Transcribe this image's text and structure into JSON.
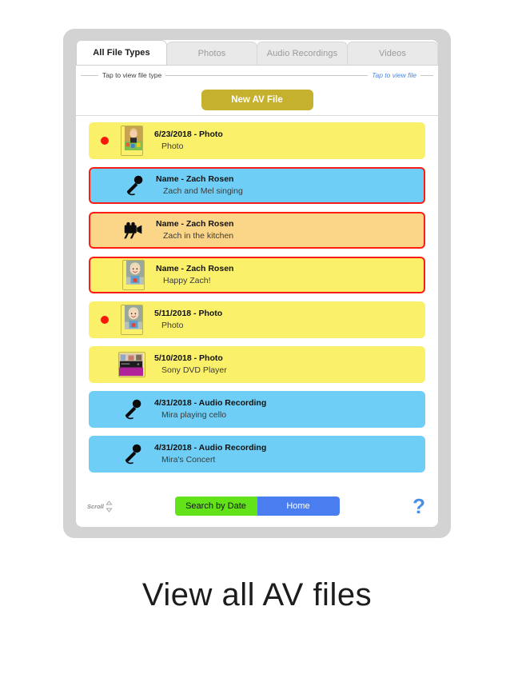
{
  "app": {
    "caption": "View all AV files"
  },
  "tabs": [
    {
      "label": "All File Types",
      "active": true
    },
    {
      "label": "Photos",
      "active": false
    },
    {
      "label": "Audio Recordings",
      "active": false
    },
    {
      "label": "Videos",
      "active": false
    }
  ],
  "annotations": {
    "left": "Tap to view file type",
    "right": "Tap to view file"
  },
  "toolbar": {
    "new_file_label": "New AV File"
  },
  "files": [
    {
      "title": "6/23/2018 - Photo",
      "subtitle": "Photo",
      "kind": "photo",
      "bg": "#FBF069",
      "selected": false,
      "dot": true,
      "thumb": "child-blocks"
    },
    {
      "title": "Name - Zach Rosen",
      "subtitle": "Zach and Mel singing",
      "kind": "audio",
      "bg": "#6FCEF5",
      "selected": true,
      "dot": false,
      "thumb": "microphone-icon"
    },
    {
      "title": "Name - Zach Rosen",
      "subtitle": "Zach in the kitchen",
      "kind": "video",
      "bg": "#FBD588",
      "selected": true,
      "dot": false,
      "thumb": "video-camera-icon"
    },
    {
      "title": "Name - Zach Rosen",
      "subtitle": "Happy Zach!",
      "kind": "photo",
      "bg": "#FBF069",
      "selected": true,
      "dot": false,
      "thumb": "child-smiling"
    },
    {
      "title": "5/11/2018 - Photo",
      "subtitle": "Photo",
      "kind": "photo",
      "bg": "#FBF069",
      "selected": false,
      "dot": true,
      "thumb": "child-smiling"
    },
    {
      "title": "5/10/2018 - Photo",
      "subtitle": "Sony DVD Player",
      "kind": "photo",
      "bg": "#FBF069",
      "selected": false,
      "dot": false,
      "thumb": "dvd-player"
    },
    {
      "title": "4/31/2018 - Audio Recording",
      "subtitle": "Mira playing cello",
      "kind": "audio",
      "bg": "#6FCEF5",
      "selected": false,
      "dot": false,
      "thumb": "microphone-icon"
    },
    {
      "title": "4/31/2018 - Audio Recording",
      "subtitle": "Mira's Concert",
      "kind": "audio",
      "bg": "#6FCEF5",
      "selected": false,
      "dot": false,
      "thumb": "microphone-icon"
    }
  ],
  "bottom": {
    "scroll_label": "Scroll",
    "search_label": "Search by Date",
    "home_label": "Home",
    "help_label": "?"
  },
  "colors": {
    "photo_row": "#FBF069",
    "audio_row": "#6FCEF5",
    "video_row": "#FBD588",
    "selected_border": "#FB1E14",
    "record_dot": "#FB1707",
    "new_file_button": "#C6B12E",
    "search_button": "#63E219",
    "home_button": "#4A7DF0",
    "help_icon": "#4A90E2",
    "annotation_blue": "#4A86E8",
    "frame": "#D3D3D3"
  }
}
